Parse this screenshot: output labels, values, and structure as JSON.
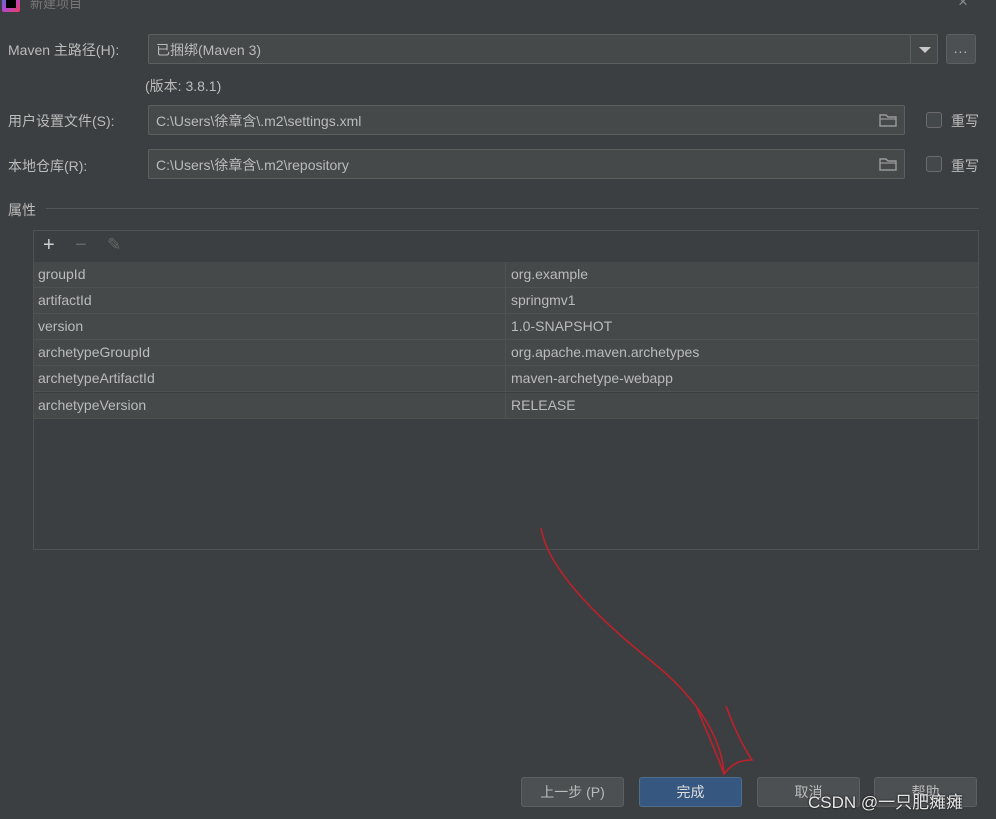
{
  "window": {
    "title": "新建项目",
    "close": "×"
  },
  "maven": {
    "home_label": "Maven 主路径(H):",
    "home_value": "已捆绑(Maven 3)",
    "browse": "...",
    "version_text": "(版本: 3.8.1)",
    "settings_label": "用户设置文件(S):",
    "settings_value": "C:\\Users\\徐章含\\.m2\\settings.xml",
    "override_label": "重写",
    "repo_label": "本地仓库(R):",
    "repo_value": "C:\\Users\\徐章含\\.m2\\repository",
    "override2_label": "重写"
  },
  "properties": {
    "heading": "属性",
    "toolbar": {
      "add": "+",
      "remove": "−",
      "edit": "✎"
    },
    "rows": [
      {
        "key": "groupId",
        "value": "org.example"
      },
      {
        "key": "artifactId",
        "value": "springmv1"
      },
      {
        "key": "version",
        "value": "1.0-SNAPSHOT"
      },
      {
        "key": "archetypeGroupId",
        "value": "org.apache.maven.archetypes"
      },
      {
        "key": "archetypeArtifactId",
        "value": "maven-archetype-webapp"
      },
      {
        "key": "archetypeVersion",
        "value": "RELEASE"
      }
    ]
  },
  "buttons": {
    "prev": "上一步 (P)",
    "finish": "完成",
    "cancel": "取消",
    "help": "帮助"
  },
  "watermark": "CSDN @一只肥瘫瘫",
  "colors": {
    "background": "#3c3f41",
    "primary_button": "#365880",
    "annotation_arrow": "#c0202a"
  }
}
